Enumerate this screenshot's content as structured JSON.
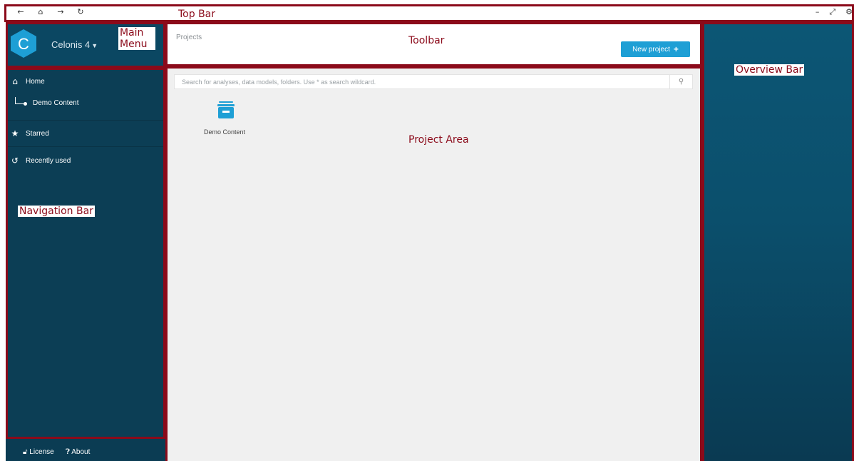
{
  "topbar": {
    "nav_icons": [
      "arrow-left-icon",
      "home-icon",
      "arrow-right-icon",
      "refresh-icon"
    ],
    "window_icons": [
      "minimize-icon",
      "restore-icon",
      "settings-icon"
    ],
    "annotation": "Top Bar"
  },
  "main_menu": {
    "logo_letter": "C",
    "product_label": "Celonis 4",
    "annotation_line1": "Main",
    "annotation_line2": "Menu"
  },
  "navigation": {
    "items": [
      {
        "label": "Home",
        "icon": "home-icon"
      },
      {
        "label": "Demo Content",
        "icon": "tree-node-icon"
      },
      {
        "label": "Starred",
        "icon": "star-icon"
      },
      {
        "label": "Recently used",
        "icon": "history-icon"
      }
    ],
    "annotation": "Navigation Bar"
  },
  "footer": {
    "license_label": "License",
    "about_label": "About"
  },
  "toolbar": {
    "breadcrumb": "Projects",
    "new_project_label": "New project",
    "annotation": "Toolbar"
  },
  "project_area": {
    "search_placeholder": "Search for analyses, data models, folders. Use * as search wildcard.",
    "projects": [
      {
        "label": "Demo Content",
        "icon": "archive-box-icon"
      }
    ],
    "annotation": "Project Area"
  },
  "overview": {
    "annotation": "Overview Bar"
  },
  "colors": {
    "accent": "#1e9fd5",
    "sidebar": "#0c3e55",
    "annotation": "#8b0a1a"
  }
}
